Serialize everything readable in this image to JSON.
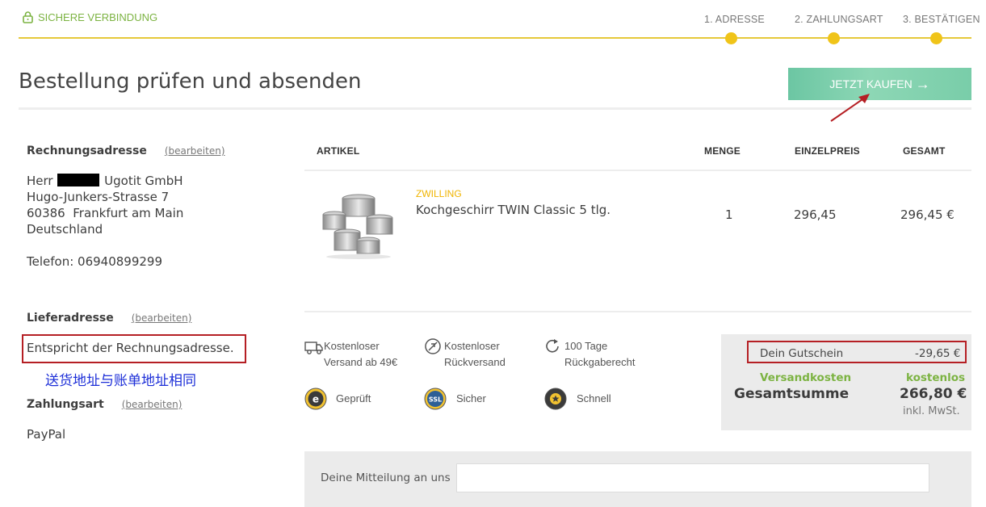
{
  "header": {
    "secure_label": "SICHERE VERBINDUNG",
    "steps": [
      {
        "label": "1. ADRESSE"
      },
      {
        "label": "2. ZAHLUNGSART"
      },
      {
        "label": "3. BESTÄTIGEN"
      }
    ]
  },
  "page": {
    "title": "Bestellung prüfen und absenden",
    "buy_button": "JETZT KAUFEN"
  },
  "billing": {
    "heading": "Rechnungsadresse",
    "edit": "(bearbeiten)",
    "salutation": "Herr",
    "company": "Ugotit GmbH",
    "street": "Hugo-Junkers-Strasse 7",
    "city": "60386  Frankfurt am Main",
    "country": "Deutschland",
    "phone": "Telefon: 06940899299"
  },
  "delivery": {
    "heading": "Lieferadresse",
    "edit": "(bearbeiten)",
    "same_as_billing": "Entspricht der Rechnungsadresse."
  },
  "annotation": {
    "chinese_note": "送货地址与账单地址相同"
  },
  "payment": {
    "heading": "Zahlungsart",
    "edit": "(bearbeiten)",
    "method": "PayPal"
  },
  "table": {
    "headers": {
      "article": "ARTIKEL",
      "quantity": "MENGE",
      "unit_price": "EINZELPREIS",
      "total": "GESAMT"
    },
    "items": [
      {
        "brand": "ZWILLING",
        "name": "Kochgeschirr TWIN Classic 5 tlg.",
        "quantity": "1",
        "unit_price": "296,45",
        "total": "296,45 €"
      }
    ]
  },
  "badges": [
    {
      "icon": "truck-icon",
      "line1": "Kostenloser",
      "line2": "Versand ab 49€"
    },
    {
      "icon": "return-circle-icon",
      "line1": "Kostenloser",
      "line2": "Rückversand"
    },
    {
      "icon": "refresh-icon",
      "line1": "100 Tage",
      "line2": "Rückgaberecht"
    },
    {
      "icon": "trusted-shops-icon",
      "line1": "Geprüft",
      "line2": ""
    },
    {
      "icon": "ssl-icon",
      "line1": "Sicher",
      "line2": ""
    },
    {
      "icon": "star-badge-icon",
      "line1": "Schnell",
      "line2": ""
    }
  ],
  "summary": {
    "voucher_label": "Dein Gutschein",
    "voucher_value": "-29,65 €",
    "shipping_label": "Versandkosten",
    "shipping_value": "kostenlos",
    "total_label": "Gesamtsumme",
    "total_value": "266,80 €",
    "tax_note": "inkl. MwSt."
  },
  "message": {
    "label": "Deine Mitteilung an uns",
    "placeholder": ""
  },
  "colors": {
    "accent_yellow": "#f0c419",
    "buy_green": "#79cda9",
    "shipping_green": "#7cb342",
    "annotation_red": "#b51f24",
    "annotation_blue": "#1d2fd8"
  }
}
